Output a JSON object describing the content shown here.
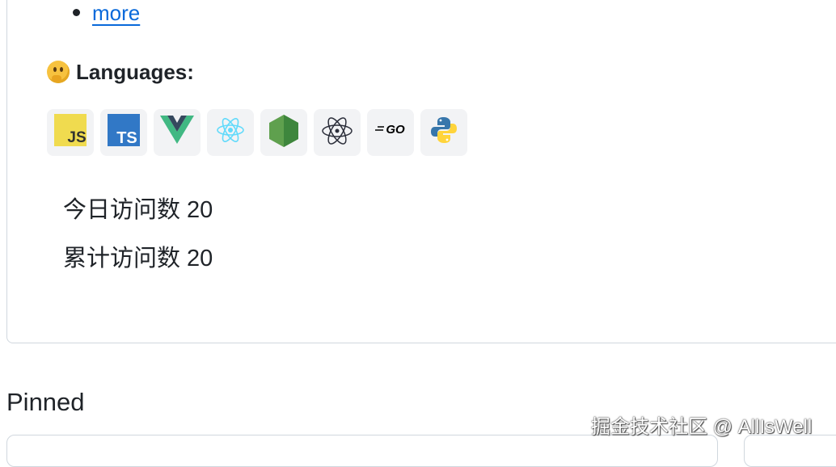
{
  "profile": {
    "more_link": "more",
    "languages_heading": "Languages:",
    "languages": [
      {
        "name": "JavaScript",
        "icon": "javascript-icon",
        "label": "JS",
        "color": "#f0db4f"
      },
      {
        "name": "TypeScript",
        "icon": "typescript-icon",
        "label": "TS",
        "color": "#3178c6"
      },
      {
        "name": "Vue",
        "icon": "vue-icon",
        "color": "#41b883"
      },
      {
        "name": "React",
        "icon": "react-icon",
        "color": "#61dafb"
      },
      {
        "name": "Node.js",
        "icon": "nodejs-icon",
        "color": "#5fa04e"
      },
      {
        "name": "Electron",
        "icon": "electron-icon",
        "color": "#47848f"
      },
      {
        "name": "Go",
        "icon": "go-icon",
        "label": "GO",
        "color": "#000000"
      },
      {
        "name": "Python",
        "icon": "python-icon",
        "color": "#3776ab"
      }
    ],
    "visit_today": "今日访问数 20",
    "visit_total": "累计访问数 20"
  },
  "pinned": {
    "title": "Pinned"
  },
  "watermark": "掘金技术社区 @ AllIsWell"
}
